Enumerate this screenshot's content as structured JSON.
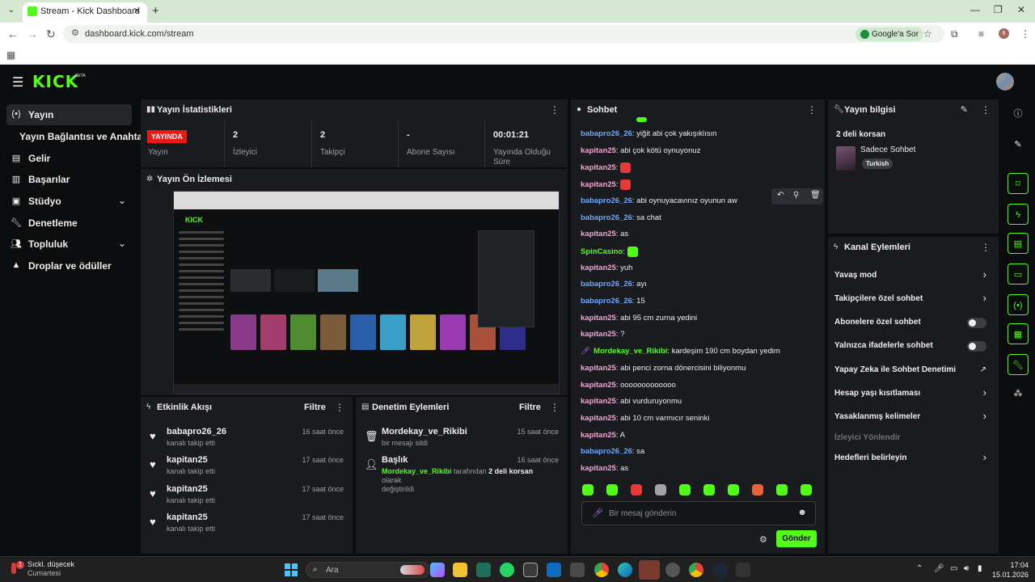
{
  "browser": {
    "tab_title": "Stream - Kick Dashboard",
    "url": "dashboard.kick.com/stream",
    "google_ask": "Google'a Sor",
    "profile_initial": "6"
  },
  "kick": {
    "logo": "KICK",
    "beta": "BETA"
  },
  "sidebar": {
    "items": [
      {
        "label": "Yayın"
      },
      {
        "label": "Yayın Bağlantısı ve Anahtarı"
      },
      {
        "label": "Gelir"
      },
      {
        "label": "Başarılar"
      },
      {
        "label": "Stüdyo"
      },
      {
        "label": "Denetleme"
      },
      {
        "label": "Topluluk"
      },
      {
        "label": "Droplar ve ödüller"
      }
    ]
  },
  "stats": {
    "title": "Yayın İstatistikleri",
    "live_badge": "YAYINDA",
    "items": [
      {
        "value": "",
        "label": "Yayın"
      },
      {
        "value": "2",
        "label": "İzleyici"
      },
      {
        "value": "2",
        "label": "Takipçi"
      },
      {
        "value": "-",
        "label": "Abone Sayısı"
      },
      {
        "value": "00:01:21",
        "label": "Yayında Olduğu Süre"
      }
    ]
  },
  "preview": {
    "title": "Yayın Ön İzlemesi"
  },
  "activity": {
    "title": "Etkinlik Akışı",
    "filter": "Filtre",
    "events": [
      {
        "name": "babapro26_26",
        "sub": "kanalı takip etti",
        "time": "16 saat önce"
      },
      {
        "name": "kapitan25",
        "sub": "kanalı takip etti",
        "time": "17 saat önce"
      },
      {
        "name": "kapitan25",
        "sub": "kanalı takip etti",
        "time": "17 saat önce"
      },
      {
        "name": "kapitan25",
        "sub": "kanalı takip etti",
        "time": "17 saat önce"
      }
    ]
  },
  "moderation": {
    "title": "Denetim Eylemleri",
    "filter": "Filtre",
    "events": [
      {
        "name": "Mordekay_ve_Rikibi",
        "sub": "bir mesajı sildi",
        "time": "15 saat önce"
      },
      {
        "name": "Başlık",
        "sub_user": "Mordekay_ve_Rikibi",
        "sub_mid": " tarafından ",
        "sub_title": "2 deli korsan",
        "sub_end": " olarak",
        "sub2": "değiştirildi",
        "time": "16 saat önce"
      }
    ]
  },
  "chat": {
    "title": "Sohbet",
    "messages": [
      {
        "user": "babapro26_26",
        "color": "#6fa8ff",
        "text": ": yiğit abi çok yakışıklısın"
      },
      {
        "user": "kapitan25",
        "color": "#f0a6d4",
        "text": ": abi çok kötü oynuyonuz"
      },
      {
        "user": "kapitan25",
        "color": "#f0a6d4",
        "text": ": ",
        "emote": "#e63a3a"
      },
      {
        "user": "kapitan25",
        "color": "#f0a6d4",
        "text": ": ",
        "emote": "#e63a3a"
      },
      {
        "user": "babapro26_26",
        "color": "#6fa8ff",
        "text": ": abi oynuyacavınız oyunun aw"
      },
      {
        "user": "babapro26_26",
        "color": "#6fa8ff",
        "text": ": sa chat"
      },
      {
        "user": "kapitan25",
        "color": "#f0a6d4",
        "text": ": as"
      },
      {
        "user": "SpinCasino",
        "color": "#53fc18",
        "text": ": ",
        "emote": "#53fc18"
      },
      {
        "user": "kapitan25",
        "color": "#f0a6d4",
        "text": ": yuh"
      },
      {
        "user": "babapro26_26",
        "color": "#6fa8ff",
        "text": ": ayı"
      },
      {
        "user": "babapro26_26",
        "color": "#6fa8ff",
        "text": ": 15"
      },
      {
        "user": "kapitan25",
        "color": "#f0a6d4",
        "text": ": abi 95 cm zurna yedini"
      },
      {
        "user": "kapitan25",
        "color": "#f0a6d4",
        "text": ": ?"
      },
      {
        "user": "Mordekay_ve_Rikibi",
        "color": "#53fc18",
        "text": ": kardeşim 190 cm boydan yedim",
        "badge": true
      },
      {
        "user": "kapitan25",
        "color": "#f0a6d4",
        "text": ": abi penci zorna dönercisini biliyonmu"
      },
      {
        "user": "kapitan25",
        "color": "#f0a6d4",
        "text": ": ooooooooooooo"
      },
      {
        "user": "kapitan25",
        "color": "#f0a6d4",
        "text": ": abi vurduruyonmu"
      },
      {
        "user": "kapitan25",
        "color": "#f0a6d4",
        "text": ": abi 10 cm varmıcır seninki"
      },
      {
        "user": "kapitan25",
        "color": "#f0a6d4",
        "text": ": A"
      },
      {
        "user": "babapro26_26",
        "color": "#6fa8ff",
        "text": ": sa"
      },
      {
        "user": "kapitan25",
        "color": "#f0a6d4",
        "text": ": as"
      }
    ],
    "emote_colors": [
      "#53fc18",
      "#53fc18",
      "#e63a3a",
      "#a3a3a3",
      "#53fc18",
      "#53fc18",
      "#53fc18",
      "#e8623a",
      "#53fc18",
      "#53fc18"
    ],
    "input_placeholder": "Bir mesaj gönderin",
    "send": "Gönder"
  },
  "stream_info": {
    "title": "Yayın bilgisi",
    "stream_title": "2 deli korsan",
    "category": "Sadece Sohbet",
    "tag": "Turkish"
  },
  "channel_actions": {
    "title": "Kanal Eylemleri",
    "items": [
      {
        "label": "Yavaş mod",
        "kind": "chevron"
      },
      {
        "label": "Takipçilere özel sohbet",
        "kind": "chevron"
      },
      {
        "label": "Abonelere özel sohbet",
        "kind": "toggle"
      },
      {
        "label": "Yalnızca ifadelerle sohbet",
        "kind": "toggle"
      },
      {
        "label": "Yapay Zeka ile Sohbet Denetimi",
        "kind": "external"
      },
      {
        "label": "Hesap yaşı kısıtlaması",
        "kind": "chevron"
      },
      {
        "label": "Yasaklanmış kelimeler",
        "kind": "chevron"
      },
      {
        "label": "İzleyici Yönlendir",
        "kind": "disabled"
      },
      {
        "label": "Hedefleri belirleyin",
        "kind": "chevron"
      }
    ]
  },
  "taskbar": {
    "weather_title": "Sıckl. düşecek",
    "weather_sub": "Cumartesi",
    "weather_badge": "1",
    "search": "Ara",
    "time": "17:04",
    "date": "15.01.2026"
  }
}
